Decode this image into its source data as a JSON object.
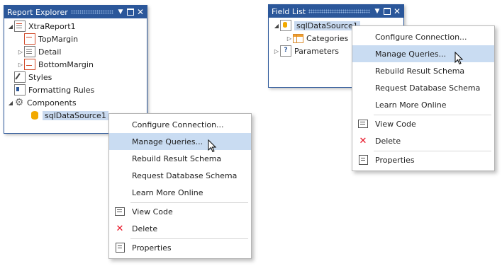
{
  "report_explorer": {
    "title": "Report Explorer",
    "nodes": {
      "report": "XtraReport1",
      "top_margin": "TopMargin",
      "detail": "Detail",
      "bottom_margin": "BottomMargin",
      "styles": "Styles",
      "formatting_rules": "Formatting Rules",
      "components": "Components",
      "datasource": "sqlDataSource1"
    }
  },
  "field_list": {
    "title": "Field List",
    "nodes": {
      "datasource": "sqlDataSource1",
      "categories": "Categories",
      "parameters": "Parameters"
    }
  },
  "context_menu": {
    "items": {
      "configure": "Configure Connection...",
      "manage": "Manage Queries...",
      "rebuild": "Rebuild Result Schema",
      "request": "Request Database Schema",
      "learn": "Learn More Online",
      "view_code": "View Code",
      "delete": "Delete",
      "properties": "Properties"
    },
    "highlighted": "Manage Queries..."
  },
  "colors": {
    "header": "#2b579a",
    "highlight": "#c9dcf2",
    "delete_icon": "#e81123"
  }
}
